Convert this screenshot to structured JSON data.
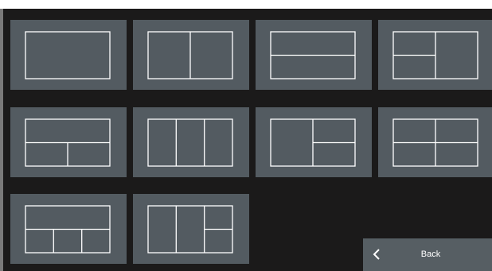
{
  "layouts": [
    {
      "name": "single"
    },
    {
      "name": "split-vertical-2"
    },
    {
      "name": "split-horizontal-2"
    },
    {
      "name": "left-split-right-full"
    },
    {
      "name": "top-full-bottom-split"
    },
    {
      "name": "split-vertical-3"
    },
    {
      "name": "left-full-right-split"
    },
    {
      "name": "quad"
    },
    {
      "name": "top-full-bottom-3"
    },
    {
      "name": "vertical-2-right-split"
    }
  ],
  "back_button": {
    "label": "Back",
    "icon": "chevron-left-icon"
  },
  "colors": {
    "screen": "#1b1a1a",
    "tile": "#535b61",
    "outline": "#ffffff"
  }
}
